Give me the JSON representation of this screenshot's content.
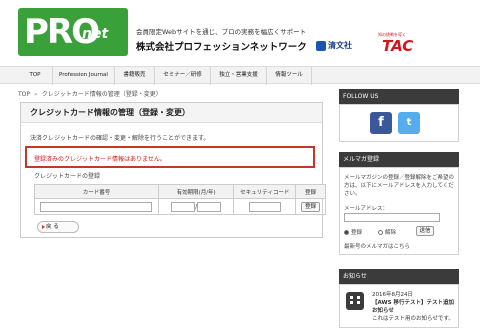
{
  "header": {
    "logo_main": "PRO",
    "logo_sub": "net",
    "tagline": "会員限定Webサイトを通じ、プロの実務を幅広くサポート",
    "company": "株式会社プロフェッションネットワーク",
    "partner1": "清文社",
    "partner2_small": "知の挑戦を導く",
    "partner2_big": "TAC"
  },
  "nav": {
    "items": [
      {
        "label": "TOP"
      },
      {
        "label": "Profession Journal"
      },
      {
        "label": "書籍販売"
      },
      {
        "label": "セミナー／研修"
      },
      {
        "label": "独立・営業支援"
      },
      {
        "label": "情報ツール"
      }
    ]
  },
  "breadcrumb": {
    "home": "TOP",
    "separator": "»",
    "current": "クレジットカード情報の管理（登録・変更）"
  },
  "panel": {
    "title": "クレジットカード情報の管理（登録・変更）",
    "description": "決済クレジットカードの確認・変更・解除を行うことができます。",
    "alert": "登録済みのクレジットカード情報はありません。",
    "register_label": "クレジットカードの登録",
    "table": {
      "headers": [
        "カード番号",
        "有効期限(月/年)",
        "セキュリティコード",
        "登録"
      ],
      "slash": "/",
      "register_button": "登録"
    },
    "back_button": "戻 る"
  },
  "sidebar": {
    "follow_title": "FOLLOW US",
    "facebook_glyph": "f",
    "twitter_glyph": "t",
    "mailmag_title": "メルマガ登録",
    "mailmag_text": "メールマガジンの登録／登録解除をご希望の方は、以下にメールアドレスを入力してください。",
    "mail_label": "メールアドレス：",
    "radio_register": "登録",
    "radio_cancel": "解除",
    "send_button": "送信",
    "backnumber_link": "最新号のメルマガはこちら",
    "news_title": "お知らせ",
    "news_date": "2016年8月24日",
    "news_headline": "【AWS 移行テスト】テスト追加お知らせ",
    "news_body": "これはテスト用のお知らせです。"
  },
  "colors": {
    "brand_green": "#3aa13a",
    "alert_red": "#c0392b",
    "sidebar_header": "#3b3b3b"
  }
}
